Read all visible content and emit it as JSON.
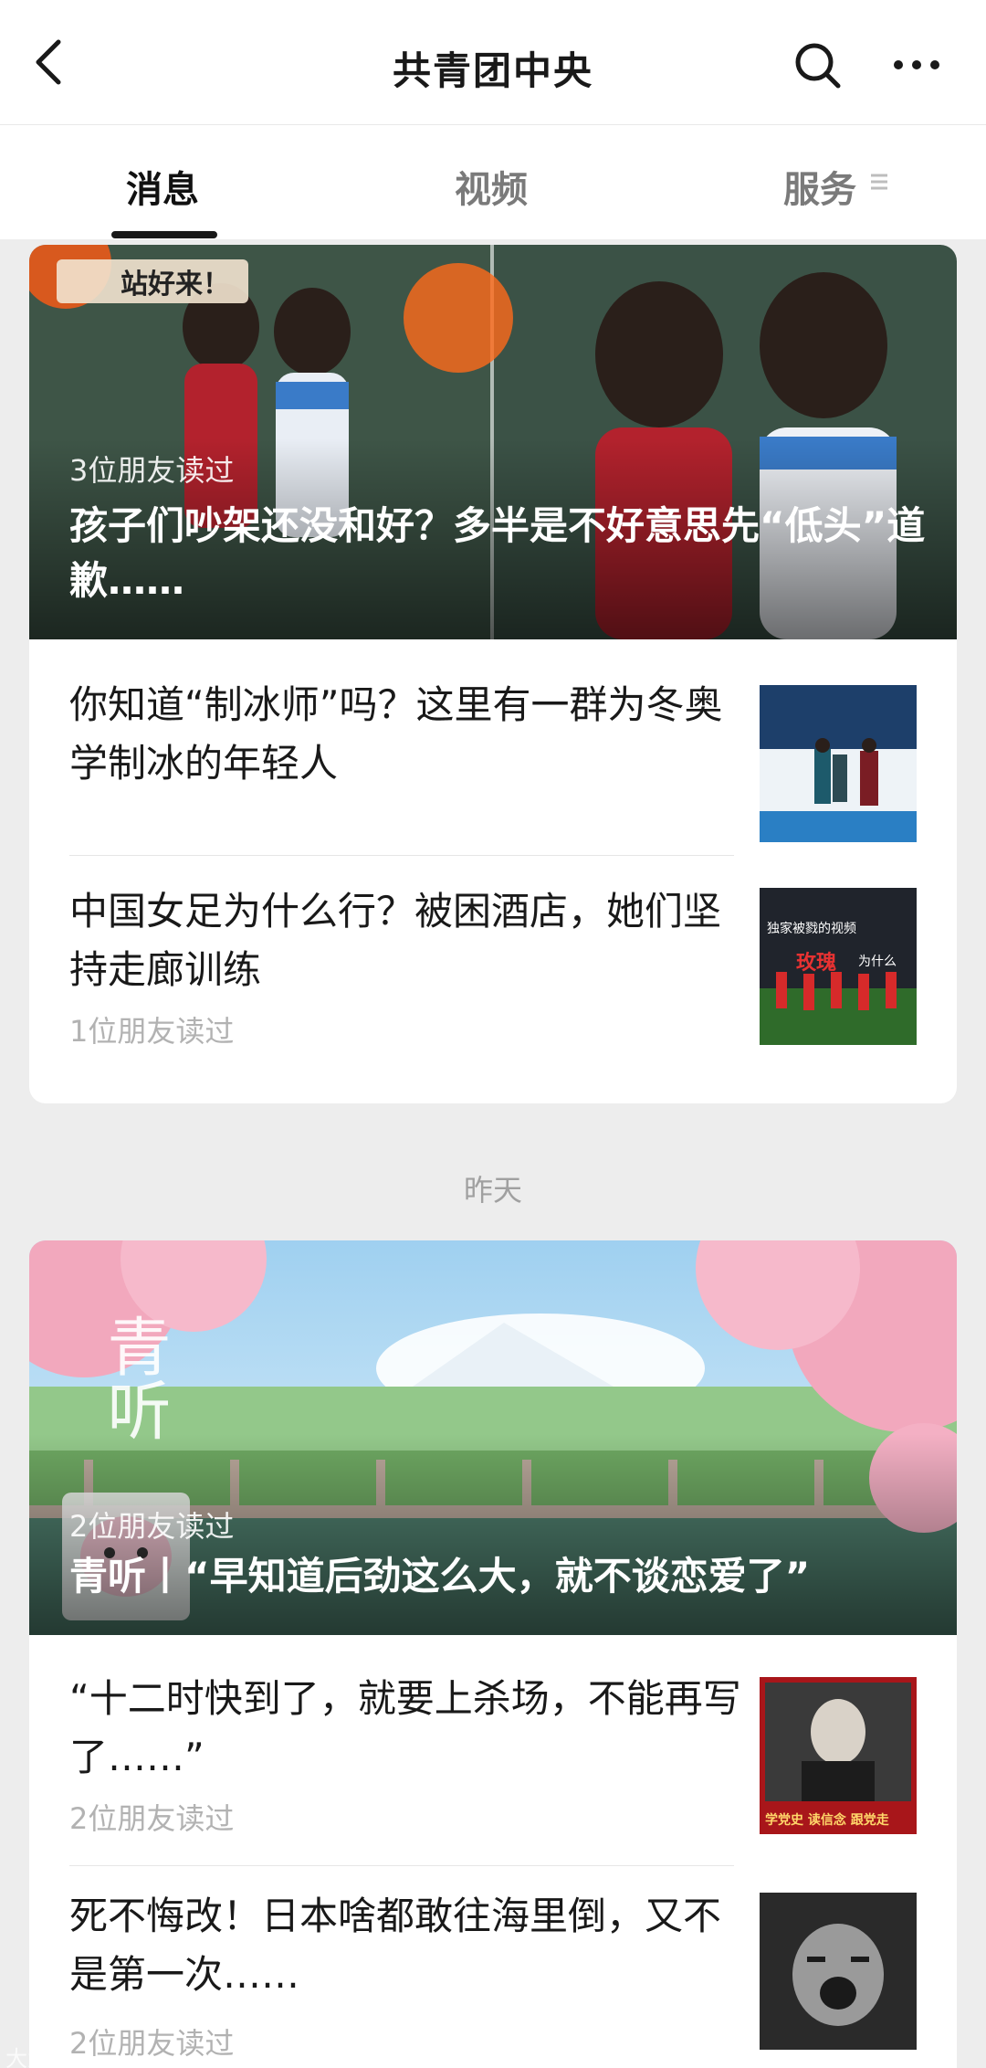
{
  "header": {
    "title": "共青团中央",
    "back_icon": "back-chevron-icon",
    "search_icon": "search-icon",
    "more_icon": "more-dots-icon"
  },
  "tabs": [
    {
      "label": "消息",
      "active": true
    },
    {
      "label": "视频",
      "active": false
    },
    {
      "label": "服务",
      "active": false
    }
  ],
  "group1": {
    "cover": {
      "readers": "3位朋友读过",
      "title": "孩子们吵架还没和好？多半是不好意思先“低头”道歉……",
      "caption": "站好来！"
    },
    "items": [
      {
        "title": "你知道“制冰师”吗？这里有一群为冬奥学制冰的年轻人",
        "readers": ""
      },
      {
        "title": "中国女足为什么行？被困酒店，她们坚持走廊训练",
        "readers": "1位朋友读过",
        "thumb_text_1": "独家被戮的视频",
        "thumb_text_2": "玫瑰",
        "thumb_text_3": "为什么"
      }
    ]
  },
  "date_label": "昨天",
  "group2": {
    "cover": {
      "logo": "青听",
      "readers": "2位朋友读过",
      "title": "青听丨“早知道后劲这么大，就不谈恋爱了”"
    },
    "items": [
      {
        "title": "“十二时快到了，就要上杀场，不能再写了……”",
        "readers": "2位朋友读过",
        "thumb_caption": "学党史 读信念 跟党走"
      },
      {
        "title": "死不悔改！日本啥都敢往海里倒，又不是第一次……",
        "readers": "2位朋友读过"
      }
    ]
  },
  "watermark": "大鱼号"
}
